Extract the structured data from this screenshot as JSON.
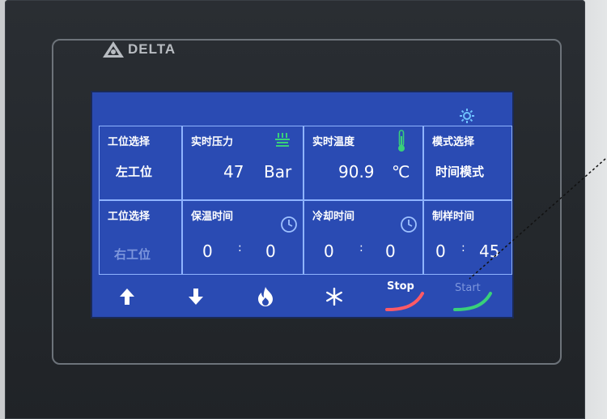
{
  "brand": {
    "logo_text": "DELTA",
    "icon": "delta-triangle-icon"
  },
  "screen": {
    "settings_icon": "gear-icon",
    "cells": {
      "station_select_1": {
        "label": "工位选择",
        "value": "左工位"
      },
      "pressure": {
        "label": "实时压力",
        "value": "47",
        "unit": "Bar",
        "icon": "press-icon"
      },
      "temperature": {
        "label": "实时温度",
        "value": "90.9",
        "unit": "℃",
        "icon": "thermometer-icon"
      },
      "mode_select": {
        "label": "模式选择",
        "value": "时间模式"
      },
      "station_select_2": {
        "label": "工位选择",
        "value": "右工位"
      },
      "hold_time": {
        "label": "保温时间",
        "min": "0",
        "sep": ":",
        "sec": "0",
        "icon": "clock-icon"
      },
      "cool_time": {
        "label": "冷却时间",
        "min": "0",
        "sep": ":",
        "sec": "0",
        "icon": "clock-icon"
      },
      "sample_time": {
        "label": "制样时间",
        "min": "0",
        "sep": ":",
        "sec": "45"
      }
    },
    "toolbar": {
      "up": {
        "icon": "arrow-up-icon"
      },
      "down": {
        "icon": "arrow-down-icon"
      },
      "heat": {
        "icon": "flame-icon"
      },
      "cool": {
        "icon": "snowflake-icon"
      },
      "stop": {
        "label": "Stop"
      },
      "start": {
        "label": "Start"
      }
    }
  },
  "colors": {
    "screen_bg": "#2a4bb3",
    "grid_line": "#8fb4ff",
    "icon_green": "#39d07a",
    "stop_red": "#ff5a66",
    "start_green": "#39d07a"
  }
}
